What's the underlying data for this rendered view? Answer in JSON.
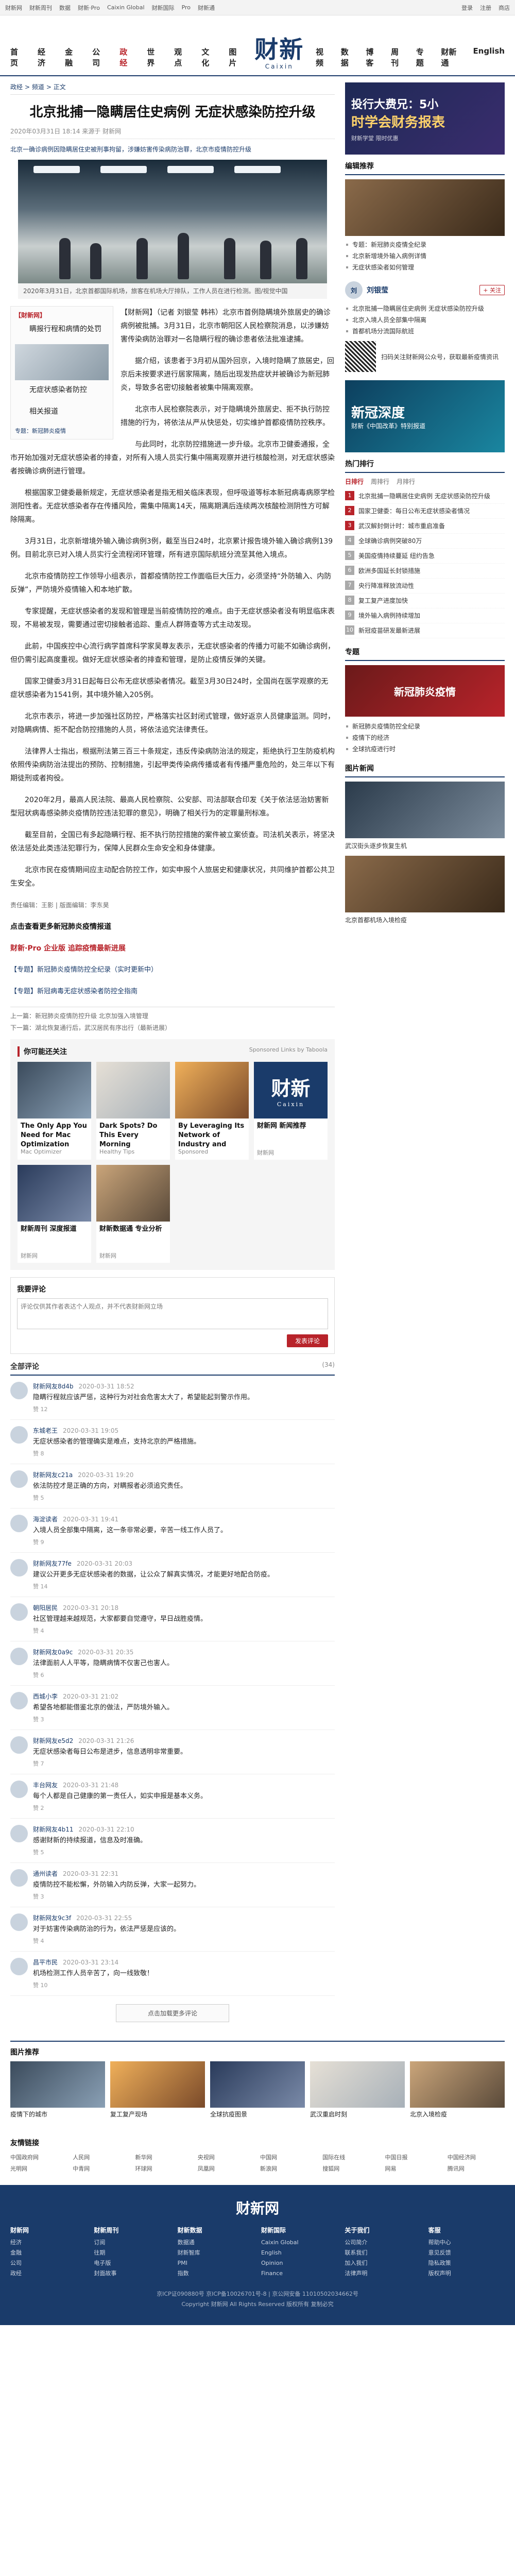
{
  "topbar": {
    "items": [
      "财新网",
      "财新周刊",
      "数据",
      "财新·Pro",
      "Caixin Global",
      "财新国际",
      "Pro",
      "财新通"
    ],
    "right": [
      "登录",
      "注册",
      "商店"
    ]
  },
  "header": {
    "nav_left": [
      "首页",
      "经济",
      "金融",
      "公司",
      "政经",
      "世界",
      "观点",
      "文化",
      "图片"
    ],
    "nav_right": [
      "视频",
      "数据",
      "博客",
      "周刊",
      "专题",
      "财新通",
      "English"
    ],
    "logo_cn": "财新",
    "logo_en": "Caixin"
  },
  "crumb": [
    "政经",
    "频道",
    "正文"
  ],
  "article": {
    "title": "北京批捕一隐瞒居住史病例 无症状感染防控升级",
    "meta": "2020年03月31日 18:14 来源于 财新网",
    "subhead": "北京一确诊病例因隐瞒居住史被刑事拘留，涉嫌妨害传染病防治罪，北京市疫情防控升级",
    "photo_caption": "2020年3月31日，北京首都国际机场，旅客在机场大厅排队，工作人员在进行检测。图/视觉中国",
    "float_title": "【財新网】",
    "float_lines": [
      "瞒报行程和病情的处罚",
      "无症状感染者防控",
      "相关报道"
    ],
    "float_tag": "专题：新冠肺炎疫情",
    "paragraphs": [
      "【财新网】（记者 刘银莹 韩祎）北京市首例隐瞒境外旅居史的确诊病例被批捕。3月31日，北京市朝阳区人民检察院消息，以涉嫌妨害传染病防治罪对一名隐瞒行程的确诊患者依法批准逮捕。",
      "据介绍，该患者于3月初从国外回京，入境时隐瞒了旅居史，回京后未按要求进行居家隔离，随后出现发热症状并被确诊为新冠肺炎，导致多名密切接触者被集中隔离观察。",
      "北京市人民检察院表示，对于隐瞒境外旅居史、拒不执行防控措施的行为，将依法从严从快惩处，切实维护首都疫情防控秩序。",
      "与此同时，北京防控措施进一步升级。北京市卫健委通报，全市开始加强对无症状感染者的排查，对所有入境人员实行集中隔离观察并进行核酸检测，对无症状感染者按确诊病例进行管理。",
      "根据国家卫健委最新规定，无症状感染者是指无相关临床表现，但呼吸道等标本新冠病毒病原学检测阳性者。无症状感染者存在传播风险，需集中隔离14天，隔离期满后连续两次核酸检测阴性方可解除隔离。",
      "3月31日，北京新增境外输入确诊病例3例，截至当日24时，北京累计报告境外输入确诊病例139例。目前北京已对入境人员实行全流程闭环管理，所有进京国际航班分流至其他入境点。",
      "北京市疫情防控工作领导小组表示，首都疫情防控工作面临巨大压力，必须坚持“外防输入、内防反弹”，严防境外疫情输入和本地扩散。",
      "专家提醒，无症状感染者的发现和管理是当前疫情防控的难点。由于无症状感染者没有明显临床表现，不易被发现，需要通过密切接触者追踪、重点人群筛查等方式主动发现。",
      "此前，中国疾控中心流行病学首席科学家吴尊友表示，无症状感染者的传播力可能不如确诊病例，但仍需引起高度重视。做好无症状感染者的排查和管理，是防止疫情反弹的关键。",
      "国家卫健委3月31日起每日公布无症状感染者情况。截至3月30日24时，全国尚在医学观察的无症状感染者为1541例，其中境外输入205例。",
      "北京市表示，将进一步加强社区防控，严格落实社区封闭式管理，做好返京人员健康监测。同时，对隐瞒病情、拒不配合防控措施的人员，将依法追究法律责任。",
      "法律界人士指出，根据刑法第三百三十条规定，违反传染病防治法的规定，拒绝执行卫生防疫机构依照传染病防治法提出的预防、控制措施，引起甲类传染病传播或者有传播严重危险的，处三年以下有期徒刑或者拘役。",
      "2020年2月，最高人民法院、最高人民检察院、公安部、司法部联合印发《关于依法惩治妨害新型冠状病毒感染肺炎疫情防控违法犯罪的意见》，明确了相关行为的定罪量刑标准。",
      "截至目前，全国已有多起隐瞒行程、拒不执行防控措施的案件被立案侦查。司法机关表示，将坚决依法惩处此类违法犯罪行为，保障人民群众生命安全和身体健康。",
      "北京市民在疫情期间应主动配合防控工作，如实申报个人旅居史和健康状况，共同维护首都公共卫生安全。"
    ],
    "reporter": "责任编辑：王影 | 版面编辑：李东昊",
    "promo": "点击查看更多新冠肺炎疫情报道",
    "pro_sub": "财新·Pro 企业版 追踪疫情最新进展",
    "related_a": "【专题】新冠肺炎疫情防控全纪录（实时更新中）",
    "related_b": "【专题】新冠病毒无症状感染者防控全指南",
    "pager_prev": "上一篇：新冠肺炎疫情防控升级 北京加强入境管理",
    "pager_next": "下一篇：湖北恢复通行后，武汉居民有序出行（最新进展）"
  },
  "rec": {
    "title": "你可能还关注",
    "sponsor": "Sponsored Links by Taboola",
    "cards": [
      {
        "t": "The Only App You Need for Mac Optimization",
        "s": "Mac Optimizer"
      },
      {
        "t": "Dark Spots? Do This Every Morning",
        "s": "Healthy Tips"
      },
      {
        "t": "By Leveraging Its Network of Industry and Community Partners...",
        "s": "Sponsored"
      },
      {
        "t": "财新网 新闻推荐",
        "s": "财新网"
      },
      {
        "t": "财新周刊 深度报道",
        "s": "财新网"
      },
      {
        "t": "财新数据通 专业分析",
        "s": "财新网"
      }
    ]
  },
  "comment_box": {
    "title": "我要评论",
    "placeholder": "评论仅供其作者表达个人观点，并不代表财新网立场",
    "submit": "发表评论"
  },
  "comments": {
    "title": "全部评论",
    "count": "(34)",
    "more": "点击加载更多评论",
    "items": [
      {
        "name": "财新网友8d4b",
        "time": "2020-03-31 18:52",
        "text": "隐瞒行程就应该严惩，这种行为对社会危害太大了，希望能起到警示作用。",
        "likes": "赞 12"
      },
      {
        "name": "东城老王",
        "time": "2020-03-31 19:05",
        "text": "无症状感染者的管理确实是难点，支持北京的严格措施。",
        "likes": "赞 8"
      },
      {
        "name": "财新网友c21a",
        "time": "2020-03-31 19:20",
        "text": "依法防控才是正确的方向，对瞒报者必须追究责任。",
        "likes": "赞 5"
      },
      {
        "name": "海淀读者",
        "time": "2020-03-31 19:41",
        "text": "入境人员全部集中隔离，这一条非常必要，辛苦一线工作人员了。",
        "likes": "赞 9"
      },
      {
        "name": "财新网友77fe",
        "time": "2020-03-31 20:03",
        "text": "建议公开更多无症状感染者的数据，让公众了解真实情况，才能更好地配合防疫。",
        "likes": "赞 14"
      },
      {
        "name": "朝阳居民",
        "time": "2020-03-31 20:18",
        "text": "社区管理越来越规范，大家都要自觉遵守，早日战胜疫情。",
        "likes": "赞 4"
      },
      {
        "name": "财新网友0a9c",
        "time": "2020-03-31 20:35",
        "text": "法律面前人人平等，隐瞒病情不仅害己也害人。",
        "likes": "赞 6"
      },
      {
        "name": "西城小李",
        "time": "2020-03-31 21:02",
        "text": "希望各地都能借鉴北京的做法，严防境外输入。",
        "likes": "赞 3"
      },
      {
        "name": "财新网友e5d2",
        "time": "2020-03-31 21:26",
        "text": "无症状感染者每日公布是进步，信息透明非常重要。",
        "likes": "赞 7"
      },
      {
        "name": "丰台网友",
        "time": "2020-03-31 21:48",
        "text": "每个人都是自己健康的第一责任人，如实申报是基本义务。",
        "likes": "赞 2"
      },
      {
        "name": "财新网友4b11",
        "time": "2020-03-31 22:10",
        "text": "感谢财新的持续报道，信息及时准确。",
        "likes": "赞 5"
      },
      {
        "name": "通州读者",
        "time": "2020-03-31 22:31",
        "text": "疫情防控不能松懈，外防输入内防反弹，大家一起努力。",
        "likes": "赞 3"
      },
      {
        "name": "财新网友9c3f",
        "time": "2020-03-31 22:55",
        "text": "对于妨害传染病防治的行为，依法严惩是应该的。",
        "likes": "赞 4"
      },
      {
        "name": "昌平市民",
        "time": "2020-03-31 23:14",
        "text": "机场检测工作人员辛苦了，向一线致敬！",
        "likes": "赞 10"
      }
    ]
  },
  "side": {
    "ad1_line1": "投行大费兄：5小",
    "ad1_line2": "时学会财务报表",
    "ad1_sub": "财新学堂 限时优惠",
    "focus_title": "编辑推荐",
    "focus_items": [
      "专题：新冠肺炎疫情全纪录",
      "北京新增境外输入病例详情",
      "无症状感染者如何管理"
    ],
    "author_name": "刘银莹",
    "author_follow": "+ 关注",
    "author_items": [
      "北京批捕一隐瞒居住史病例 无症状感染防控升级",
      "北京入境人员全部集中隔离",
      "首都机场分流国际航班"
    ],
    "qr_text": "扫码关注财新网公众号，获取最新疫情资讯",
    "ad2_big": "新冠深度",
    "ad2_sub": "财新《中国改革》特别报道",
    "rank_title": "热门排行",
    "rank_tabs": [
      "日排行",
      "周排行",
      "月排行"
    ],
    "rank_items": [
      "北京批捕一隐瞒居住史病例 无症状感染防控升级",
      "国家卫健委：每日公布无症状感染者情况",
      "武汉解封倒计时：城市重启准备",
      "全球确诊病例突破80万",
      "美国疫情持续蔓延 纽约告急",
      "欧洲多国延长封锁措施",
      "央行降准释放流动性",
      "复工复产进度加快",
      "境外输入病例持续增加",
      "新冠疫苗研发最新进展"
    ],
    "topic_title": "专题",
    "topic_banner": "新冠肺炎疫情",
    "topic_items": [
      "新冠肺炎疫情防控全纪录",
      "疫情下的经济",
      "全球抗疫进行时"
    ],
    "photo_title": "图片新闻",
    "photo_cap1": "武汉街头逐步恢复生机",
    "photo_cap2": "北京首都机场入境检疫"
  },
  "bottom": {
    "title": "图片推荐",
    "cards": [
      "疫情下的城市",
      "复工复产现场",
      "全球抗疫图景",
      "武汉重启时刻",
      "北京入境检疫"
    ],
    "links_title": "友情链接",
    "links": [
      "中国政府网",
      "人民网",
      "新华网",
      "央视网",
      "中国网",
      "国际在线",
      "中国日报",
      "中国经济网",
      "光明网",
      "中青网",
      "环球网",
      "凤凰网",
      "新浪网",
      "搜狐网",
      "网易",
      "腾讯网"
    ]
  },
  "footer": {
    "logo": "财新网",
    "cols": [
      {
        "h": "财新网",
        "items": [
          "经济",
          "金融",
          "公司",
          "政经"
        ]
      },
      {
        "h": "财新周刊",
        "items": [
          "订阅",
          "往期",
          "电子版",
          "封面故事"
        ]
      },
      {
        "h": "财新数据",
        "items": [
          "数据通",
          "财新智库",
          "PMI",
          "指数"
        ]
      },
      {
        "h": "财新国际",
        "items": [
          "Caixin Global",
          "English",
          "Opinion",
          "Finance"
        ]
      },
      {
        "h": "关于我们",
        "items": [
          "公司简介",
          "联系我们",
          "加入我们",
          "法律声明"
        ]
      },
      {
        "h": "客服",
        "items": [
          "帮助中心",
          "意见反馈",
          "隐私政策",
          "版权声明"
        ]
      }
    ],
    "copy1": "京ICP证090880号 京ICP备10026701号-8 | 京公网安备 11010502034662号",
    "copy2": "Copyright 财新网 All Rights Reserved 版权所有 复制必究"
  }
}
